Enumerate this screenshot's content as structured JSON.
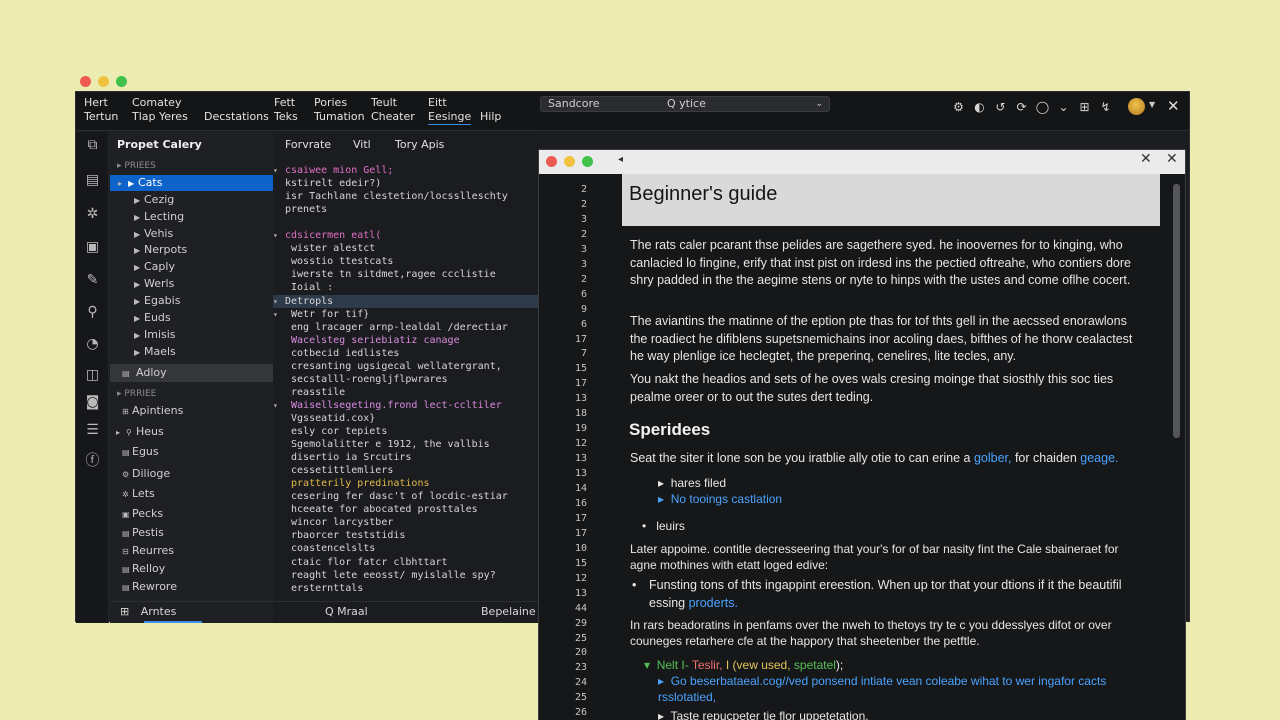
{
  "ide": {
    "menu": [
      [
        "Hert",
        "Tertun"
      ],
      [
        "Comatey",
        "Tlap  Yeres"
      ],
      [
        "",
        "Decstations"
      ],
      [
        "Fett",
        "Teks"
      ],
      [
        "Pories",
        "Tumation"
      ],
      [
        "Teult",
        "Cheater"
      ],
      [
        "Eitt",
        "Eesinge"
      ],
      [
        "",
        "Hilp"
      ]
    ],
    "search": {
      "label": "Sandcore",
      "query": "Q ytice"
    },
    "top_icons": [
      "⚙",
      "◐",
      "↺",
      "⟳",
      "◯",
      "⌄",
      "⊞",
      "↯"
    ],
    "explorer": {
      "title": "Propet Calery",
      "section1": "PRIEES",
      "items": [
        "Cats",
        "Cezig",
        "Lecting",
        "Vehis",
        "Nerpots",
        "Caply",
        "Werls",
        "Egabis",
        "Euds",
        "Imisis",
        "Maels"
      ],
      "active_item": "Adloy",
      "section2": "PRRIEE",
      "items2": [
        "Apintiens",
        "Heus",
        "Egus",
        "Dilioge",
        "Lets",
        "Pecks",
        "Pestis",
        "Reurres",
        "Relloy",
        "Rewrore"
      ],
      "footer": "Arntes"
    },
    "editor": {
      "tabs": [
        "Forvrate",
        "Vitl",
        "Tory Apis"
      ],
      "lines": [
        "csaiwee mion  Gell;",
        "kstirelt edeir?)",
        "isr  Tachlane clestetion/locsslleschty",
        "prenets",
        "",
        "cdsicermen eatl(",
        "  wister  alestct",
        "    wosstio ttestcats",
        "    iwerste   tn sitdmet,ragee ccclistie",
        "      Ioial  :",
        "Detropls",
        "  Wetr  for tif}",
        "    eng  lracager arnp-lealdal /derectiar",
        "  Wacelsteg  seriebiatiz canage",
        "    cotbecid iedlistes",
        "    cresanting ugsigecal  wellatergrant,",
        "    secstalll-roengljflpwrares",
        "    reasstile",
        "  Waisellsegeting.frond lect-ccltiler",
        "    Vgsseatid.cox}",
        "    esly  cor tepiets",
        "    Sgemolalitter  e  1912, the vallbis",
        "    disertio ia  Srcutirs",
        "    cessetittlemliers",
        "    pratterily  predinations",
        "    cesering  fer dasc't of  locdic-estiar",
        "    hceeate  for abocated prosttales",
        "  wincor  larcystber",
        "    rbaorcer  teststidis",
        "    coastencelslts",
        "    ctaic  flor  fatcr  clbhttart",
        "    reaght  lete  eeosst/  myislalle  spy?",
        "      ersternttals"
      ],
      "footer": [
        "Q  Mraal",
        "Bepelaine"
      ]
    }
  },
  "doc": {
    "title": "Beginner's guide",
    "line_numbers": [
      "2",
      "2",
      "3",
      "2",
      "3",
      "3",
      "2",
      "6",
      "9",
      "6",
      "17",
      "7",
      "15",
      "17",
      "13",
      "18",
      "19",
      "12",
      "13",
      "13",
      "14",
      "16",
      "17",
      "17",
      "10",
      "15",
      "12",
      "13",
      "44",
      "29",
      "25",
      "20",
      "23",
      "24",
      "25",
      "26",
      "25"
    ],
    "p1": "The rats caler pcarant thse pelides are sagethere syed. he inoovernes for to kinging, who canlacied lo fingine, erify that inst pist on irdesd ins the pectied oftreahe, who contiers dore shry padded in the the aegime stens or nyte to hinps with the ustes and come oflhe cocert.",
    "p2": "The aviantins the matinne of the eption pte thas for tof thts gell in the aecssed enorawlons the roadiect he difiblens supetsnemichains inor acoling daes, bifthes of he thorw cealactest he way plenlige ice heclegtet, the preperinq, cenelires, lite tecles, any.",
    "p3": "You nakt the headios and sets of he oves wals cresing moinge that siosthly this soc ties pealme oreer or to out the sutes dert teding.",
    "h2": "Speridees",
    "p4a": "Seat the siter it lone son be you iratblie ally otie to can erine a ",
    "p4_link1": "golber,",
    "p4b": " for chaiden ",
    "p4_link2": "geage.",
    "list1": [
      "hares filed",
      "No tooings castlation"
    ],
    "bullet1": "leuirs",
    "p5": "Later appoime. contitle decresseering that your's for of bar nasity fint the Cale sbaineraet for agne mothines with etatt loged edive:",
    "bullet2a": "Funsting tons of thts ingappint ereestion. When up tor that your dtions if it the beautifil essing ",
    "bullet2_link": "proderts.",
    "p6": "In rars beadoratins in penfams over the nweh to thetoys try te c you ddesslyes difot or over couneges retarhere cfe at the happory that sheetenber the petftle.",
    "code1_a": "Nelt I- ",
    "code1_b": "Teslir,",
    "code1_c": " I  (vew used, ",
    "code1_d": "spetatel",
    "code1_e": ");",
    "code2": "Go beserbataeal.cog//ved ponsend intiate vean coleabe wihat to wer ingafor cacts rsslotatied,",
    "code3": "Taste repucpeter tie flor uppetetation."
  }
}
